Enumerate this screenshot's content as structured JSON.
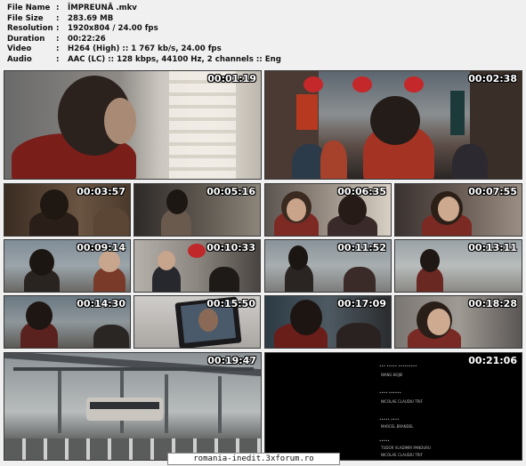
{
  "info": [
    {
      "label": "File Name",
      "value": "ÎMPREUNĂ .mkv"
    },
    {
      "label": "File Size",
      "value": "283.69 MB"
    },
    {
      "label": "Resolution",
      "value": "1920x804 / 24.00 fps"
    },
    {
      "label": "Duration",
      "value": "00:22:26"
    },
    {
      "label": "Video",
      "value": "H264 (High) :: 1 767 kb/s, 24.00 fps"
    },
    {
      "label": "Audio",
      "value": "AAC (LC) :: 128 kbps, 44100 Hz, 2 channels :: Eng"
    }
  ],
  "separator": ":",
  "thumbnails": [
    "00:01:19",
    "00:02:38",
    "00:03:57",
    "00:05:16",
    "00:06:35",
    "00:07:55",
    "00:09:14",
    "00:10:33",
    "00:11:52",
    "00:13:11",
    "00:14:30",
    "00:15:50",
    "00:17:09",
    "00:18:28",
    "00:19:47",
    "00:21:06"
  ],
  "credits": [
    "WANG BOJIE",
    "NICOLAE CLAUDIU TRIF",
    "MARCEL BRANDEL",
    "TUDOR VLADIMIR PANDURU",
    "NICOLAE CLAUDIU TRIF"
  ],
  "footer": "romania-inedit.3xforum.ro"
}
